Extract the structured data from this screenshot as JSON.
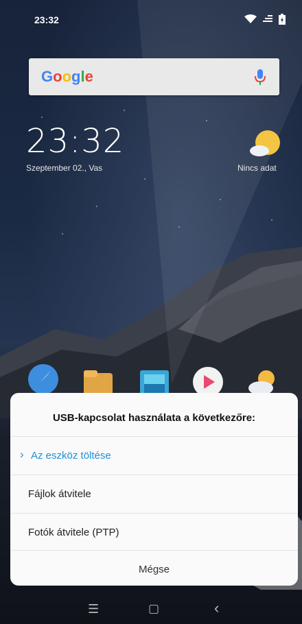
{
  "status_bar": {
    "time": "23:32"
  },
  "search": {
    "brand": "Google"
  },
  "clock": {
    "time": "23:32",
    "date": "Szeptember 02., Vas"
  },
  "weather": {
    "text": "Nincs adat"
  },
  "dialog": {
    "title": "USB-kapcsolat használata a következőre:",
    "options": [
      {
        "label": "Az eszköz töltése",
        "selected": true
      },
      {
        "label": "Fájlok átvitele",
        "selected": false
      },
      {
        "label": "Fotók átvitele (PTP)",
        "selected": false
      }
    ],
    "cancel_label": "Mégse"
  },
  "colors": {
    "accent": "#1f8fd6",
    "dialog_bg": "#fafafa"
  },
  "icons": {
    "nav_menu": "☰",
    "nav_home": "▢",
    "nav_back": "‹",
    "chevron": "›"
  }
}
